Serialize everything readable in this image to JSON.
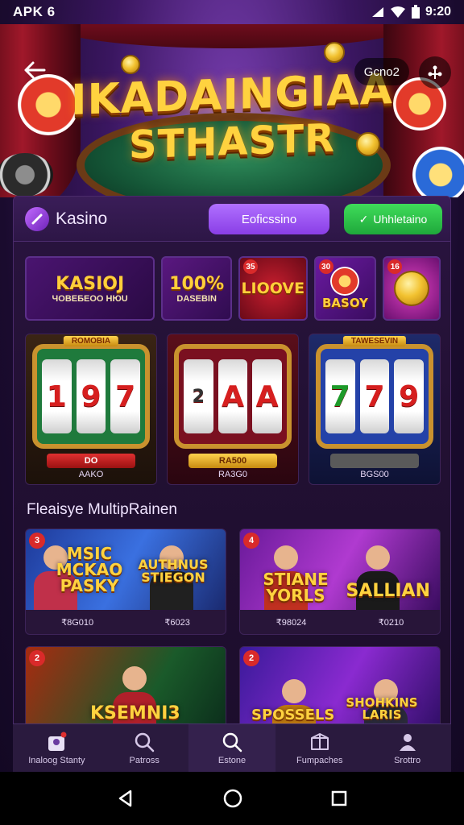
{
  "status_bar": {
    "left_label": "APK 6",
    "time": "9:20"
  },
  "hero": {
    "title_line1": "IKADAINGIAA",
    "title_line2": "STHASTR",
    "pill_label": "Gcno2"
  },
  "panel_header": {
    "brand_name": "Kasino",
    "purple_button": "Eoficssino",
    "green_button": "Uhhletaino"
  },
  "promo_tiles": [
    {
      "big": "KASIOJ",
      "small": "ЧОВЕБЕОО НЮU",
      "badge": ""
    },
    {
      "big": "100%",
      "small": "DASEBIN",
      "badge": ""
    },
    {
      "big": "LIOOVE",
      "small": "",
      "badge": "35"
    },
    {
      "big": "BASOY",
      "small": "",
      "badge": "30"
    },
    {
      "big": "",
      "small": "",
      "badge": "16"
    }
  ],
  "slots": [
    {
      "banner": "ROMOBIA",
      "reels": [
        "1",
        "9",
        "7"
      ],
      "bar": "DO",
      "caption": "AAKO"
    },
    {
      "banner": "",
      "reels": [
        "A",
        "A"
      ],
      "bar": "RA500",
      "caption": "RA3G0"
    },
    {
      "banner": "TAWESEVIN",
      "reels": [
        "7",
        "7",
        "9"
      ],
      "bar": "",
      "caption": "BGS00"
    }
  ],
  "section_title": "Fleaisye MultipRainen",
  "games": [
    {
      "num": "3",
      "title": "MSIC MCKAO PASKY",
      "subtitle": "AUTHNUS STIEGON",
      "meta": [
        "₹8G010",
        "₹6023"
      ]
    },
    {
      "num": "4",
      "title": "STIANE YORLS",
      "subtitle": "SALLIAN",
      "meta": [
        "₹98024",
        "₹0210"
      ]
    },
    {
      "num": "2",
      "title": "KSEMNI3",
      "subtitle": "",
      "meta": []
    },
    {
      "num": "2",
      "title": "SPOSSELS",
      "subtitle": "SHOHKINS LARIS",
      "meta": []
    }
  ],
  "bottom_nav": [
    {
      "label": "Inaloog Stanty",
      "icon": "game-icon"
    },
    {
      "label": "Patross",
      "icon": "search-icon"
    },
    {
      "label": "Estone",
      "icon": "search-icon"
    },
    {
      "label": "Fumpaches",
      "icon": "box-icon"
    },
    {
      "label": "Srottro",
      "icon": "user-icon"
    }
  ],
  "colors": {
    "accent_purple": "#9a4ef0",
    "accent_green": "#2bc44a",
    "gold": "#ffd23f",
    "badge_red": "#d92a2a"
  }
}
